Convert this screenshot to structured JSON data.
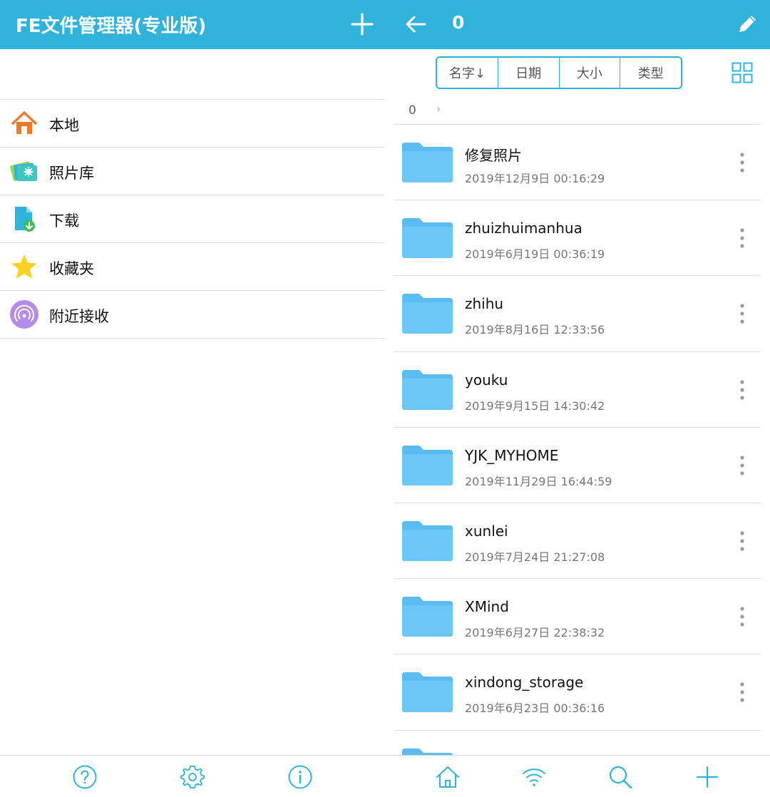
{
  "left_header": {
    "title": "FE文件管理器(专业版)",
    "add_icon": "plus-icon"
  },
  "right_header": {
    "back_icon": "arrow-left-icon",
    "title": "0",
    "edit_icon": "pencil-icon"
  },
  "nav_items": [
    {
      "label": "本地",
      "icon": "home-icon"
    },
    {
      "label": "照片库",
      "icon": "photo-library-icon"
    },
    {
      "label": "下载",
      "icon": "download-icon"
    },
    {
      "label": "收藏夹",
      "icon": "star-icon"
    },
    {
      "label": "附近接收",
      "icon": "nearby-receive-icon"
    }
  ],
  "sort": {
    "name": "名字↓",
    "date": "日期",
    "size": "大小",
    "type": "类型"
  },
  "breadcrumb": {
    "current": "0",
    "separator": "›"
  },
  "files": [
    {
      "name": "修复照片",
      "date": "2019年12月9日 00:16:29"
    },
    {
      "name": "zhuizhuimanhua",
      "date": "2019年6月19日 00:36:19"
    },
    {
      "name": "zhihu",
      "date": "2019年8月16日 12:33:56"
    },
    {
      "name": "youku",
      "date": "2019年9月15日 14:30:42"
    },
    {
      "name": "YJK_MYHOME",
      "date": "2019年11月29日 16:44:59"
    },
    {
      "name": "xunlei",
      "date": "2019年7月24日 21:27:08"
    },
    {
      "name": "XMind",
      "date": "2019年6月27日 22:38:32"
    },
    {
      "name": "xindong_storage",
      "date": "2019年6月23日 00:36:16"
    }
  ],
  "colors": {
    "accent": "#2fb3dc",
    "folder": "#5bbcf3",
    "home": "#ef7a2a",
    "star": "#ffd21f",
    "nearby": "#b58ae8"
  },
  "bottom_left_icons": [
    "help-icon",
    "settings-icon",
    "info-icon"
  ],
  "bottom_right_icons": [
    "home-icon",
    "wifi-icon",
    "search-icon",
    "add-icon"
  ]
}
